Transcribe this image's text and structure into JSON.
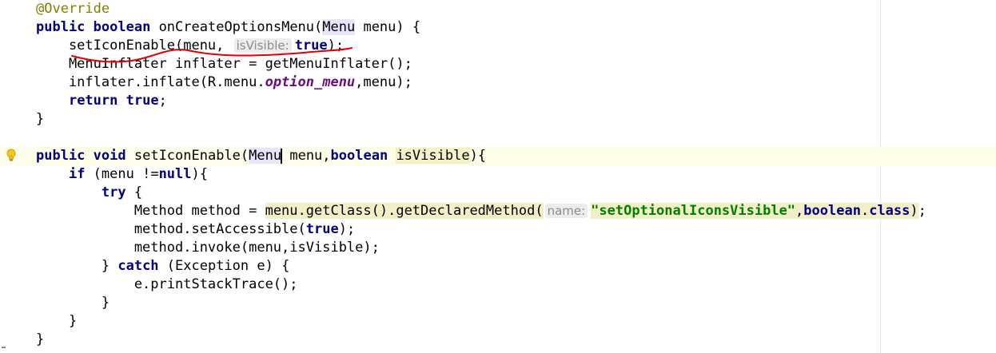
{
  "editor": {
    "lines": [
      {
        "segs": [
          {
            "t": "@Override",
            "c": "ann"
          }
        ]
      },
      {
        "segs": [
          {
            "t": "public",
            "c": "kw"
          },
          {
            "t": " "
          },
          {
            "t": "boolean",
            "c": "kw"
          },
          {
            "t": " onCreateOptionsMenu("
          },
          {
            "t": "Menu",
            "c": "ref"
          },
          {
            "t": " menu) {"
          }
        ]
      },
      {
        "segs": [
          {
            "t": "    setIconEnable(menu, "
          },
          {
            "t": "isVisible:",
            "c": "hint"
          },
          {
            "t": "true",
            "c": "kw"
          },
          {
            "t": ");"
          }
        ]
      },
      {
        "segs": [
          {
            "t": "    MenuInflater inflater = getMenuInflater();"
          }
        ]
      },
      {
        "segs": [
          {
            "t": "    inflater.inflate(R.menu."
          },
          {
            "t": "option_menu",
            "c": "fld"
          },
          {
            "t": ",menu);"
          }
        ]
      },
      {
        "segs": [
          {
            "t": "    "
          },
          {
            "t": "return",
            "c": "kw"
          },
          {
            "t": " "
          },
          {
            "t": "true",
            "c": "kw"
          },
          {
            "t": ";"
          }
        ]
      },
      {
        "segs": [
          {
            "t": "}"
          }
        ]
      },
      {
        "segs": []
      },
      {
        "hl": true,
        "bulb": true,
        "segs": [
          {
            "t": "public",
            "c": "kw"
          },
          {
            "t": " "
          },
          {
            "t": "void",
            "c": "kw"
          },
          {
            "t": " setIconEnable("
          },
          {
            "t": "Menu",
            "c": "ref"
          },
          {
            "t": "",
            "c": "caret"
          },
          {
            "t": " menu,"
          },
          {
            "t": "boolean",
            "c": "kw"
          },
          {
            "t": " "
          },
          {
            "t": "isVisible",
            "c": "param-hl"
          },
          {
            "t": "){"
          }
        ]
      },
      {
        "segs": [
          {
            "t": "    "
          },
          {
            "t": "if",
            "c": "kw"
          },
          {
            "t": " (menu !="
          },
          {
            "t": "null",
            "c": "kw"
          },
          {
            "t": "){"
          }
        ]
      },
      {
        "segs": [
          {
            "t": "        "
          },
          {
            "t": "try",
            "c": "kw"
          },
          {
            "t": " {"
          }
        ]
      },
      {
        "segs": [
          {
            "t": "            Method method = "
          },
          {
            "t": "menu.getClass().getDeclaredMethod(",
            "c": "expr-hl"
          },
          {
            "t": "name:",
            "c": "hint"
          },
          {
            "t": "\"setOptionalIconsVisible\"",
            "c": "str expr-hl"
          },
          {
            "t": ",",
            "c": "expr-hl"
          },
          {
            "t": "boolean",
            "c": "kw expr-hl"
          },
          {
            "t": ".",
            "c": "expr-hl"
          },
          {
            "t": "class",
            "c": "kw expr-hl"
          },
          {
            "t": ")",
            "c": "expr-hl"
          },
          {
            "t": ";"
          }
        ]
      },
      {
        "segs": [
          {
            "t": "            method.setAccessible("
          },
          {
            "t": "true",
            "c": "kw"
          },
          {
            "t": ");"
          }
        ]
      },
      {
        "segs": [
          {
            "t": "            method.invoke(menu,isVisible);"
          }
        ]
      },
      {
        "segs": [
          {
            "t": "        } "
          },
          {
            "t": "catch",
            "c": "kw"
          },
          {
            "t": " (Exception e) {"
          }
        ]
      },
      {
        "segs": [
          {
            "t": "            e.printStackTrace();"
          }
        ]
      },
      {
        "segs": [
          {
            "t": "        }"
          }
        ]
      },
      {
        "segs": [
          {
            "t": "    }"
          }
        ]
      },
      {
        "segs": [
          {
            "t": "}"
          }
        ]
      }
    ]
  },
  "icons": {
    "intention_bulb": "lightbulb-icon"
  },
  "colors": {
    "keyword": "#000080",
    "annotation": "#808000",
    "string": "#008000",
    "field": "#660e7a",
    "hint_text": "#8c8c8c",
    "hint_bg": "#ededed",
    "current_line": "#fdfde8",
    "annotation_stroke": "#e00000"
  }
}
